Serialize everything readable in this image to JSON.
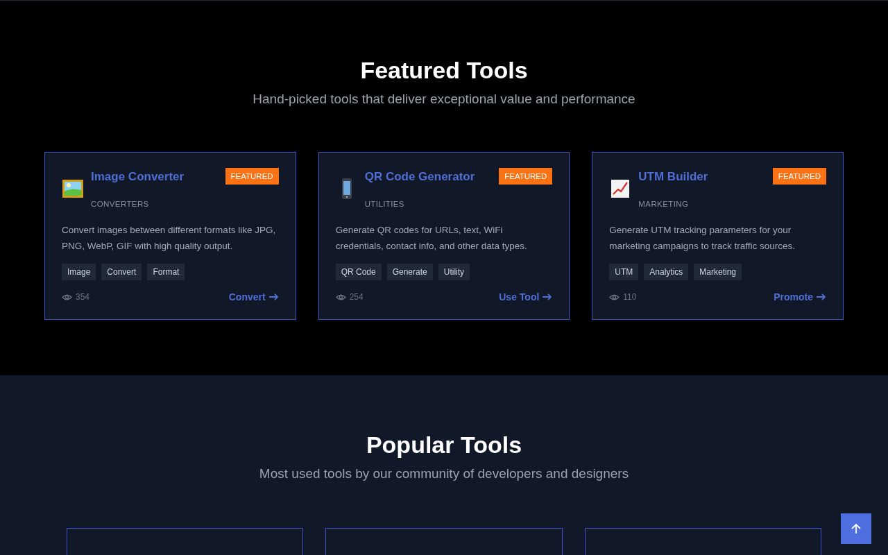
{
  "featured": {
    "title": "Featured Tools",
    "subtitle": "Hand-picked tools that deliver exceptional value and performance",
    "cards": [
      {
        "kind": "image",
        "title": "Image Converter",
        "category": "CONVERTERS",
        "badge": "FEATURED",
        "description": "Convert images between different formats like JPG, PNG, WebP, GIF with high quality output.",
        "tags": [
          "Image",
          "Convert",
          "Format"
        ],
        "views": "354",
        "action": "Convert"
      },
      {
        "kind": "mobile",
        "title": "QR Code Generator",
        "category": "UTILITIES",
        "badge": "FEATURED",
        "description": "Generate QR codes for URLs, text, WiFi credentials, contact info, and other data types.",
        "tags": [
          "QR Code",
          "Generate",
          "Utility"
        ],
        "views": "254",
        "action": "Use Tool"
      },
      {
        "kind": "marketing",
        "title": "UTM Builder",
        "category": "MARKETING",
        "badge": "FEATURED",
        "description": "Generate UTM tracking parameters for your marketing campaigns to track traffic sources.",
        "tags": [
          "UTM",
          "Analytics",
          "Marketing"
        ],
        "views": "110",
        "action": "Promote"
      }
    ]
  },
  "popular": {
    "title": "Popular Tools",
    "subtitle": "Most used tools by our community of developers and designers"
  }
}
